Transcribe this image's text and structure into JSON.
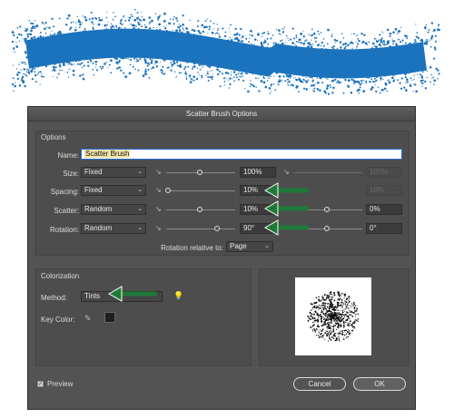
{
  "dialog": {
    "title": "Scatter Brush Options"
  },
  "options": {
    "legend": "Options",
    "name": {
      "label": "Name:",
      "value": "Scatter Brush"
    },
    "rows": [
      {
        "label": "Size:",
        "mode": "Fixed",
        "value1": "100%",
        "value2": "100%",
        "value2_disabled": true
      },
      {
        "label": "Spacing:",
        "mode": "Fixed",
        "value1": "10%",
        "value2": "10%",
        "value2_disabled": true
      },
      {
        "label": "Scatter:",
        "mode": "Random",
        "value1": "10%",
        "value2": "0%",
        "value2_disabled": false
      },
      {
        "label": "Rotation:",
        "mode": "Random",
        "value1": "90°",
        "value2": "0°",
        "value2_disabled": false
      }
    ],
    "rotation_relative": {
      "label": "Rotation relative to:",
      "value": "Page"
    }
  },
  "colorization": {
    "legend": "Colorization",
    "method_label": "Method:",
    "method_value": "Tints",
    "key_color_label": "Key Color:"
  },
  "footer": {
    "preview_label": "Preview",
    "cancel_label": "Cancel",
    "ok_label": "OK"
  },
  "colors": {
    "brush_stroke": "#1c73bd",
    "annotation_arrow": "#1f7a3a"
  }
}
